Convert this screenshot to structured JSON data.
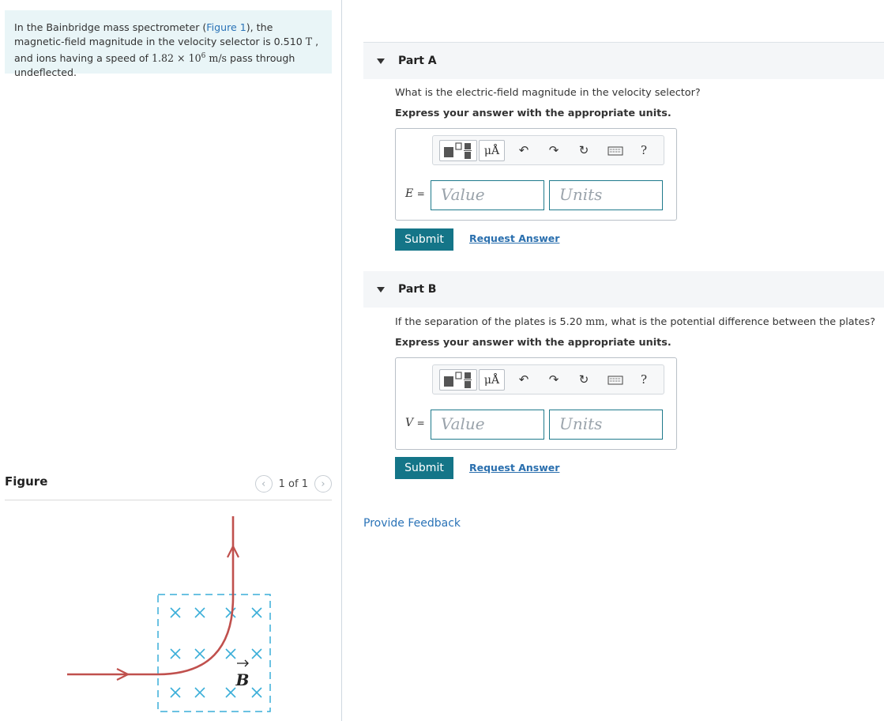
{
  "problem": {
    "text_before_link": "In the Bainbridge mass spectrometer (",
    "figure_link": "Figure 1",
    "text_after_link": "), the magnetic-field magnitude in the velocity selector is 0.510 ",
    "unit_T": "T",
    "text_ions": " , and ions having a speed of ",
    "speed_value": "1.82 × 10",
    "speed_exp": "6",
    "speed_unit": "m/s",
    "text_end": " pass through undeflected."
  },
  "figure": {
    "title": "Figure",
    "pager_text": "1 of 1",
    "prev_icon": "chevron-left-icon",
    "next_icon": "chevron-right-icon",
    "field_label": "B",
    "field_mark_symbol": "×",
    "colors": {
      "path": "#c0504d",
      "field_marks": "#3aaed8",
      "border": "#3aaed8"
    }
  },
  "parts": [
    {
      "label": "Part A",
      "question": "What is the electric-field magnitude in the velocity selector?",
      "instruction": "Express your answer with the appropriate units.",
      "variable": "E",
      "equals": "=",
      "value_placeholder": "Value",
      "units_placeholder": "Units",
      "unit_button": "μÅ",
      "help": "?",
      "submit": "Submit",
      "request_answer": "Request Answer"
    },
    {
      "label": "Part B",
      "question_before": "If the separation of the plates is 5.20 ",
      "question_unit": "mm",
      "question_after": ", what is the potential difference between the plates?",
      "instruction": "Express your answer with the appropriate units.",
      "variable": "V",
      "equals": "=",
      "value_placeholder": "Value",
      "units_placeholder": "Units",
      "unit_button": "μÅ",
      "help": "?",
      "submit": "Submit",
      "request_answer": "Request Answer"
    }
  ],
  "feedback": "Provide Feedback",
  "colors": {
    "accent": "#147588",
    "link": "#2a73b7",
    "problem_bg": "#e9f5f7"
  }
}
